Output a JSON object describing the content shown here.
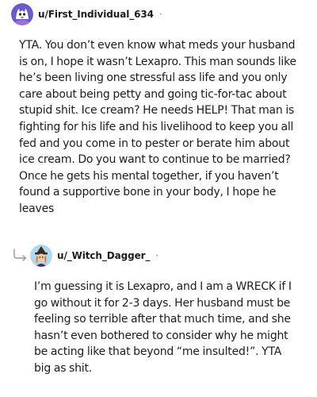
{
  "comments": [
    {
      "username": "u/First_Individual_634",
      "separator": "·",
      "avatar_icon": "purple-cat-avatar-icon",
      "text": "YTA. You don’t even know what meds your husband is on, I hope it wasn’t Lexapro. This man sounds like he’s been living one stressful ass life and you only care about being petty and going tic-for-tac about stupid shit. Ice cream? He needs HELP! That man is fighting for his life and his livelihood to keep you all fed and you come in to pester or berate him about ice cream. Do you want to continue to be married? Once he gets his mental together, if you haven’t found a supportive bone in your body, I hope he leaves"
    },
    {
      "username": "u/_Witch_Dagger_",
      "separator": "·",
      "avatar_icon": "witch-avatar-icon",
      "reply_icon": "reply-arrow-icon",
      "text": "I’m guessing it is Lexapro, and I am a WRECK if I go without it for 2-3 days. Her husband must be feeling so terrible after that much time, and she hasn’t even bothered to consider why he might be acting like that beyond “me insulted!”. YTA big as shit."
    }
  ],
  "colors": {
    "text": "#1c1c1c",
    "muted": "#7c7c7c",
    "avatar1_bg": "#6a5acd",
    "avatar2_bg": "#b0d8ef"
  }
}
